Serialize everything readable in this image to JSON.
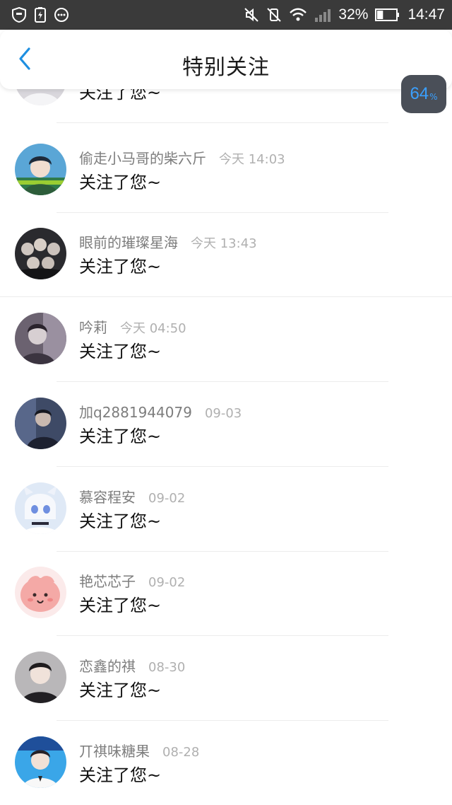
{
  "status_bar": {
    "battery_percent": "32%",
    "time": "14:47",
    "battery_level": 0.32,
    "icons": [
      "shield-icon",
      "battery-saver-icon",
      "more-icon",
      "mute-icon",
      "vibrate-off-icon",
      "wifi-icon",
      "signal-icon",
      "battery-icon"
    ]
  },
  "header": {
    "title": "特别关注",
    "back_icon": "chevron-left-icon",
    "accent_color": "#1e8fe1"
  },
  "floating_widget": {
    "value": "64",
    "unit": "%"
  },
  "list": {
    "items": [
      {
        "name": "",
        "time": "",
        "message": "关注了您~"
      },
      {
        "name": "偷走小马哥的柴六斤",
        "time": "今天 14:03",
        "message": "关注了您~"
      },
      {
        "name": "眼前的璀璨星海",
        "time": "今天 13:43",
        "message": "关注了您~"
      },
      {
        "name": "吟莉",
        "time": "今天 04:50",
        "message": "关注了您~"
      },
      {
        "name": "加q2881944079",
        "time": "09-03",
        "message": "关注了您~"
      },
      {
        "name": "慕容程安",
        "time": "09-02",
        "message": "关注了您~"
      },
      {
        "name": "艳芯芯子",
        "time": "09-02",
        "message": "关注了您~"
      },
      {
        "name": "恋鑫的祺",
        "time": "08-30",
        "message": "关注了您~"
      },
      {
        "name": "丌祺味糖果",
        "time": "08-28",
        "message": "关注了您~"
      }
    ]
  }
}
